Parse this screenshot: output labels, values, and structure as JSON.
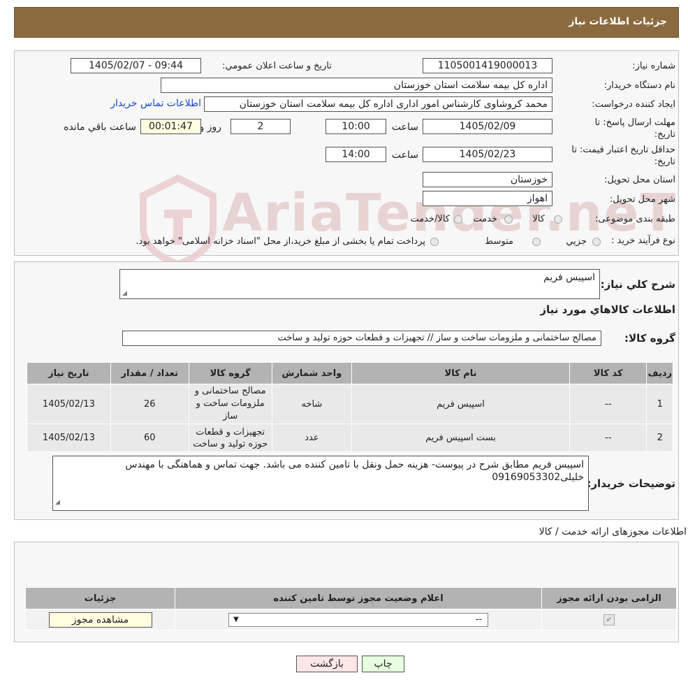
{
  "header": {
    "title": "جزئیات اطلاعات نیاز"
  },
  "watermark": {
    "text": "AriaTender.neT"
  },
  "info": {
    "need_number_label": "شماره نیاز:",
    "need_number": "1105001419000013",
    "announce_label": "تاریخ و ساعت اعلان عمومي:",
    "announce_value": "1405/02/07 - 09:44",
    "buyer_org_label": "نام دستگاه خريدار:",
    "buyer_org": "اداره کل بیمه سلامت استان خوزستان",
    "requester_label": "ايجاد کننده درخواست:",
    "requester": "محمد کروشاوی کارشناس امور اداری اداره کل بیمه سلامت استان خوزستان",
    "contact_link": "اطلاعات تماس خریدار",
    "deadline_label_1": "مهلت ارسال پاسخ: تا",
    "deadline_label_2": "تاریخ:",
    "deadline_date": "1405/02/09",
    "time_label": "ساعت",
    "deadline_time": "10:00",
    "days_value": "2",
    "days_label": "روز و",
    "remaining_time": "00:01:47",
    "remaining_label": "ساعت باقي مانده",
    "validity_label_1": "حداقل تاريخ اعتبار قيمت: تا",
    "validity_label_2": "تاريخ:",
    "validity_date": "1405/02/23",
    "validity_time": "14:00",
    "province_label": "استان محل تحويل:",
    "province": "خوزستان",
    "city_label": "شهر محل تحويل:",
    "city": "اهواز",
    "category_label": "طبقه بندی موضوعی:",
    "category_options": [
      "کالا",
      "خدمت",
      "کالا/خدمت"
    ],
    "process_label": "نوع فرآيند خريد :",
    "process_options": [
      "جزيي",
      "متوسط"
    ],
    "process_note": "پرداخت تمام یا بخشی از مبلغ خرید،از محل \"اسناد خزانه اسلامی\" خواهد بود."
  },
  "details": {
    "summary_label": "شرح کلي نياز:",
    "summary": "اسپیس فریم",
    "goods_title": "اطلاعات کالاهاي مورد نياز",
    "group_label": "گروه کالا:",
    "group_value": "مصالح ساختمانی و ملزومات ساخت و ساز // تجهیزات و قطعات حوزه تولید و ساخت",
    "table_headers": [
      "رديف",
      "کد کالا",
      "نام کالا",
      "واحد شمارش",
      "گروه کالا",
      "تعداد / مقدار",
      "تاريخ نياز"
    ],
    "rows": [
      {
        "row": "1",
        "code": "--",
        "name": "اسپیس فریم",
        "unit": "شاخه",
        "group": "مصالح ساختمانی و ملزومات ساخت و ساز",
        "qty": "26",
        "date": "1405/02/13"
      },
      {
        "row": "2",
        "code": "--",
        "name": "بست اسپیس فریم",
        "unit": "عدد",
        "group": "تجهیزات و قطعات حوزه تولید و ساخت",
        "qty": "60",
        "date": "1405/02/13"
      }
    ],
    "buyer_notes_label": "توضيحات خريدار:",
    "buyer_notes": "اسپیس فریم مطابق شرح در پیوست- هزینه حمل ونقل با تامین کننده می باشد. جهت تماس و هماهنگی با مهندس خلیلی09169053302"
  },
  "permits": {
    "title": "اطلاعات مجوزهای ارائه خدمت / کالا",
    "headers": [
      "الزامی بودن ارائه مجوز",
      "اعلام وضعیت مجوز توسط تامین کننده",
      "جزئیات"
    ],
    "select_value": "--",
    "view_button": "مشاهده مجوز"
  },
  "actions": {
    "print": "چاپ",
    "back": "بازگشت"
  }
}
